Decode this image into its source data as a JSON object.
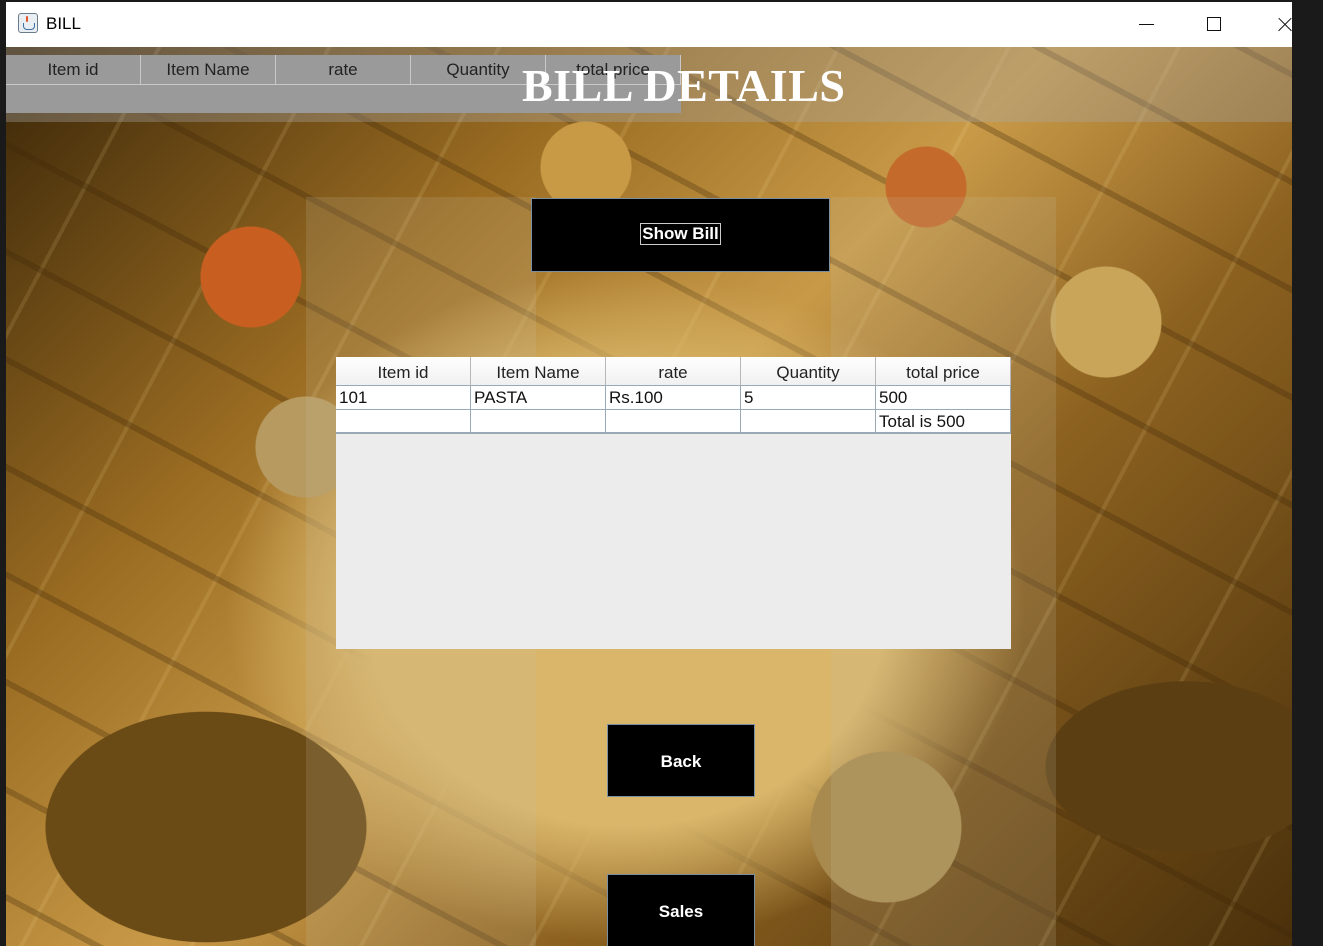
{
  "window": {
    "title": "BILL",
    "icon": "java-cup-icon",
    "controls": [
      "minimize-icon",
      "maximize-icon",
      "close-icon"
    ]
  },
  "page": {
    "title": "BILL DETAILS"
  },
  "header_columns": [
    "Item id",
    "Item Name",
    "rate",
    "Quantity",
    "total price"
  ],
  "buttons": {
    "show_bill": "Show Bill",
    "back": "Back",
    "sales": "Sales"
  },
  "table": {
    "columns": [
      "Item id",
      "Item Name",
      "rate",
      "Quantity",
      "total price"
    ],
    "rows": [
      [
        "101",
        "PASTA",
        "Rs.100",
        "5",
        "500"
      ],
      [
        "",
        "",
        "",
        "",
        "Total is 500"
      ]
    ]
  },
  "colors": {
    "button_bg": "#000000",
    "button_text": "#ffffff",
    "title_text": "#ffffff"
  }
}
